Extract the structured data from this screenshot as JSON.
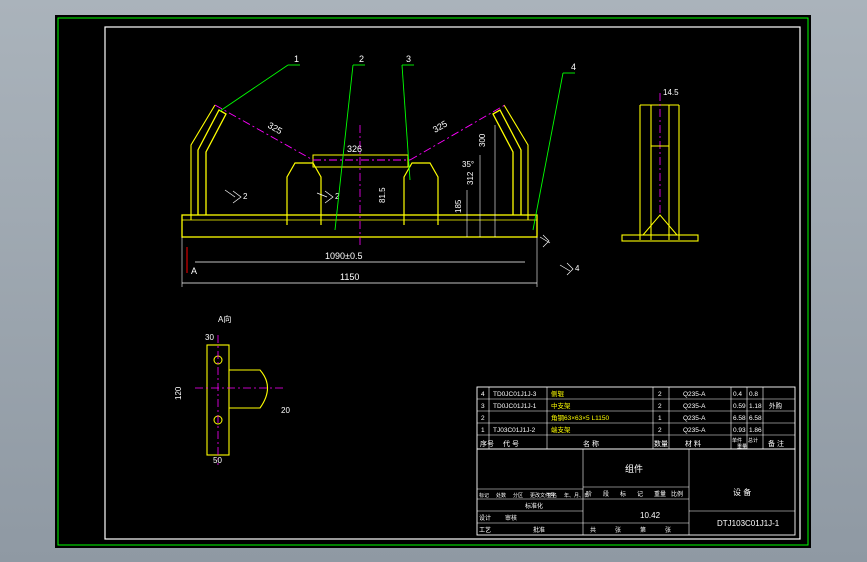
{
  "colors": {
    "background": "#000000",
    "frame": "#00ff00",
    "part": "#ffff00",
    "dimension": "#ffffff",
    "centerline": "#ff00ff",
    "leader": "#00ff00",
    "table_line": "#ffffff"
  },
  "balloons": [
    "1",
    "2",
    "3",
    "4"
  ],
  "dims": {
    "roll_angled_1": "325",
    "roll_angled_2": "325",
    "roll_center": "326",
    "height_1": "300",
    "height_2": "312",
    "height_3": "185",
    "height_4": "81.5",
    "angle": "35°",
    "span_inner": "1090±0.5",
    "span_total": "1150",
    "side_top": "14.5",
    "view_label": "A",
    "view_title": "A向",
    "plate_top": "30",
    "plate_height": "120",
    "plate_bottom": "50",
    "plate_right": "20",
    "weld_1": "2",
    "weld_2": "2",
    "weld_3": "4",
    "weld_4": "4"
  },
  "parts": [
    {
      "no": "4",
      "code": "TD0JC01J1J-3",
      "name": "侧辊",
      "qty": "2",
      "material": "Q235-A",
      "unit_w": "0.4",
      "total_w": "0.8",
      "note": ""
    },
    {
      "no": "3",
      "code": "TD0JC01J1J-1",
      "name": "中支架",
      "qty": "2",
      "material": "Q235-A",
      "unit_w": "0.59",
      "total_w": "1.18",
      "note": "外购"
    },
    {
      "no": "2",
      "code": "",
      "name": "角钢63×63×5 L1150",
      "qty": "1",
      "material": "Q235-A",
      "unit_w": "6.58",
      "total_w": "6.58",
      "note": ""
    },
    {
      "no": "1",
      "code": "TJ03C01J1J-2",
      "name": "端支架",
      "qty": "2",
      "material": "Q235-A",
      "unit_w": "0.93",
      "total_w": "1.86",
      "note": ""
    }
  ],
  "header": {
    "no": "序号",
    "code": "代    号",
    "name": "名    称",
    "qty": "数量",
    "material": "材    料",
    "unit_w": "单件",
    "total_w": "总计",
    "weight": "重量",
    "note": "备 注"
  },
  "title_block": {
    "drawing_title": "组件",
    "company": "设 备",
    "drawing_no": "DTJ103C01J1J-1",
    "weight": "10.42",
    "row1": [
      "标记",
      "处数",
      "分区",
      "更改文件号",
      "签名",
      "年、月、日"
    ],
    "row2": [
      "设计",
      "标准化"
    ],
    "row3": [
      "审核"
    ],
    "row4": [
      "工艺",
      "批准"
    ],
    "stage_labels": [
      "阶",
      "段",
      "标",
      "记",
      "重量",
      "比例"
    ],
    "sheet_labels": [
      "共",
      "张",
      "第",
      "张"
    ]
  }
}
